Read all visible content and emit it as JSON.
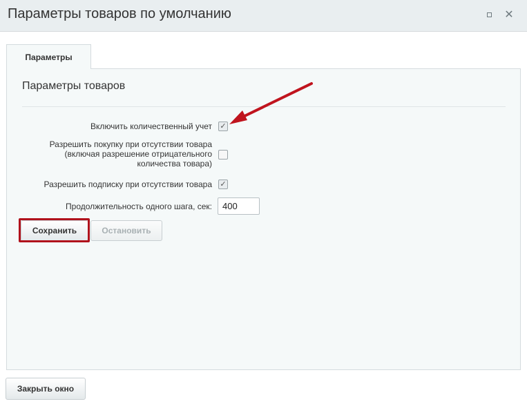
{
  "window": {
    "title": "Параметры товаров по умолчанию",
    "close_glyph": "✕"
  },
  "tabs": [
    {
      "label": "Параметры",
      "active": true
    }
  ],
  "section": {
    "title": "Параметры товаров"
  },
  "settings": {
    "quantity_tracking": {
      "label": "Включить количественный учет",
      "checked": true
    },
    "allow_purchase": {
      "label_lines": [
        "Разрешить покупку при отсутствии товара",
        "(включая разрешение отрицательного",
        "количества товара)"
      ],
      "checked": false
    },
    "allow_subscription": {
      "label": "Разрешить подписку при отсутствии товара",
      "checked": true
    },
    "step_duration": {
      "label": "Продолжительность одного шага, сек:",
      "value": "400"
    }
  },
  "buttons": {
    "save": "Сохранить",
    "stop": "Остановить",
    "close_window": "Закрыть окно"
  },
  "icons": {
    "maximize": "maximize-icon",
    "close": "close-icon",
    "check": "✓"
  },
  "colors": {
    "highlight": "#b0121c",
    "arrow": "#c0141e"
  }
}
